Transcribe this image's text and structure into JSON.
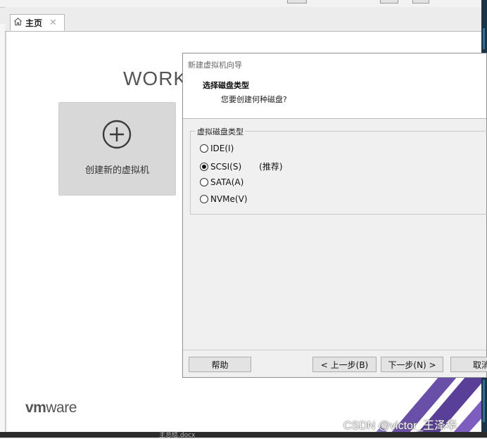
{
  "tabs": [
    {
      "label": "主页",
      "icon": "home-icon",
      "close_icon": "close-icon"
    }
  ],
  "home": {
    "welcome_title": "WORK",
    "create_vm_label": "创建新的虚拟机",
    "logo_text": "vmware"
  },
  "dialog": {
    "window_title": "新建虚拟机向导",
    "heading": "选择磁盘类型",
    "subheading": "您要创建何种磁盘?",
    "group_label": "虚拟磁盘类型",
    "options": [
      {
        "label": "IDE(I)",
        "selected": false
      },
      {
        "label": "SCSI(S)",
        "selected": true,
        "note": "(推荐)"
      },
      {
        "label": "SATA(A)",
        "selected": false
      },
      {
        "label": "NVMe(V)",
        "selected": false
      }
    ],
    "buttons": {
      "help": "帮助",
      "back": "< 上一步(B)",
      "next": "下一步(N) >",
      "cancel": "取消"
    }
  },
  "taskbar": {
    "fragment": "主总结.docx"
  },
  "watermark": "CSDN @victor_王泽华",
  "colors": {
    "card_bg": "#d8d8d8",
    "dialog_bg": "#f0f0f0",
    "header_bg": "#ffffff",
    "stripe_purple": "#6a4fa8"
  }
}
